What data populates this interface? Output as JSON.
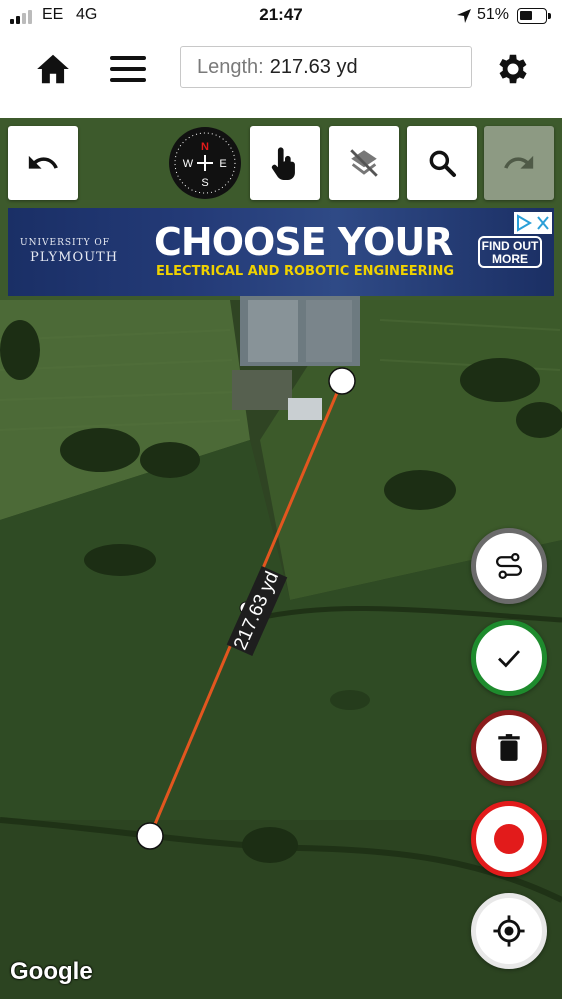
{
  "status_bar": {
    "carrier": "EE",
    "network": "4G",
    "time": "21:47",
    "battery": "51%",
    "battery_level": 0.51
  },
  "header": {
    "length_label": "Length:",
    "length_value": "217.63 yd"
  },
  "icons": {
    "home": "home-icon",
    "menu": "menu-icon",
    "settings": "gear-icon",
    "undo": "undo-icon",
    "compass": "compass-icon",
    "touch": "touch-icon",
    "layers": "layers-off-icon",
    "search": "search-icon",
    "redo": "redo-icon",
    "route": "route-icon",
    "done": "check-icon",
    "delete": "trash-icon",
    "record": "record-icon",
    "locate": "crosshair-icon"
  },
  "compass": {
    "n": "N",
    "e": "E",
    "s": "S",
    "w": "W"
  },
  "ad": {
    "university_line1": "UNIVERSITY OF",
    "university_line2": "PLYMOUTH",
    "headline": "CHOOSE YOUR",
    "subline": "ELECTRICAL AND ROBOTIC ENGINEERING",
    "cta_line1": "FIND OUT",
    "cta_line2": "MORE"
  },
  "map": {
    "measurement_label": "217.63 yd",
    "attribution": "Google"
  },
  "colors": {
    "measure_line": "#e2561f",
    "done_ring": "#1e8b2d",
    "delete_ring": "#8b1c1c",
    "record": "#e21b1b"
  }
}
